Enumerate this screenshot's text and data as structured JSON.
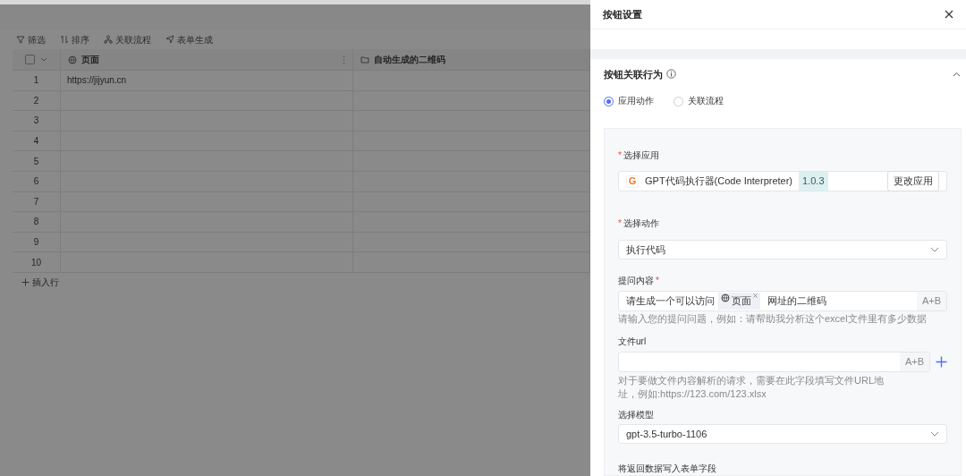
{
  "toolbar": [
    {
      "kind": "filter",
      "label": "筛选"
    },
    {
      "kind": "sort",
      "label": "排序"
    },
    {
      "kind": "flow",
      "label": "关联流程"
    },
    {
      "kind": "form",
      "label": "表单生成"
    }
  ],
  "table": {
    "select_all": {
      "checked": false
    },
    "columns": [
      {
        "kind": "globe",
        "label": "页面"
      },
      {
        "kind": "folder",
        "label": "自动生成的二维码"
      }
    ],
    "rows": [
      {
        "number": "1",
        "page": "https://jijyun.cn"
      },
      {
        "number": "2"
      },
      {
        "number": "3"
      },
      {
        "number": "4"
      },
      {
        "number": "5"
      },
      {
        "number": "6"
      },
      {
        "number": "7"
      },
      {
        "number": "8"
      },
      {
        "number": "9"
      },
      {
        "number": "10"
      }
    ],
    "insert_row": "插入行"
  },
  "drawer": {
    "title": "按钮设置",
    "section_title": "按钮关联行为",
    "expanded": true,
    "behaviors": [
      {
        "label": "应用动作",
        "selected": true
      },
      {
        "label": "关联流程",
        "selected": false
      }
    ],
    "app": {
      "label": "选择应用",
      "required": "*",
      "logo": "G",
      "name": "GPT代码执行器(Code Interpreter)",
      "version": "1.0.3",
      "change_button": "更改应用"
    },
    "action": {
      "label": "选择动作",
      "required": "*",
      "value": "执行代码"
    },
    "prompt": {
      "label": "提问内容",
      "required": "*",
      "text_before": "请生成一个可以访问",
      "token": "页面",
      "text_after": "网址的二维码",
      "formula": "A+B",
      "help": "请输入您的提问问题，例如：请帮助我分析这个excel文件里有多少数据"
    },
    "file_url": {
      "label": "文件url",
      "formula": "A+B",
      "help": "对于要做文件内容解析的请求，需要在此字段填写文件URL地址，例如:https://123.com/123.xlsx"
    },
    "model": {
      "label": "选择模型",
      "value": "gpt-3.5-turbo-1106"
    },
    "write_back": {
      "label": "将返回数据写入表单字段"
    }
  }
}
